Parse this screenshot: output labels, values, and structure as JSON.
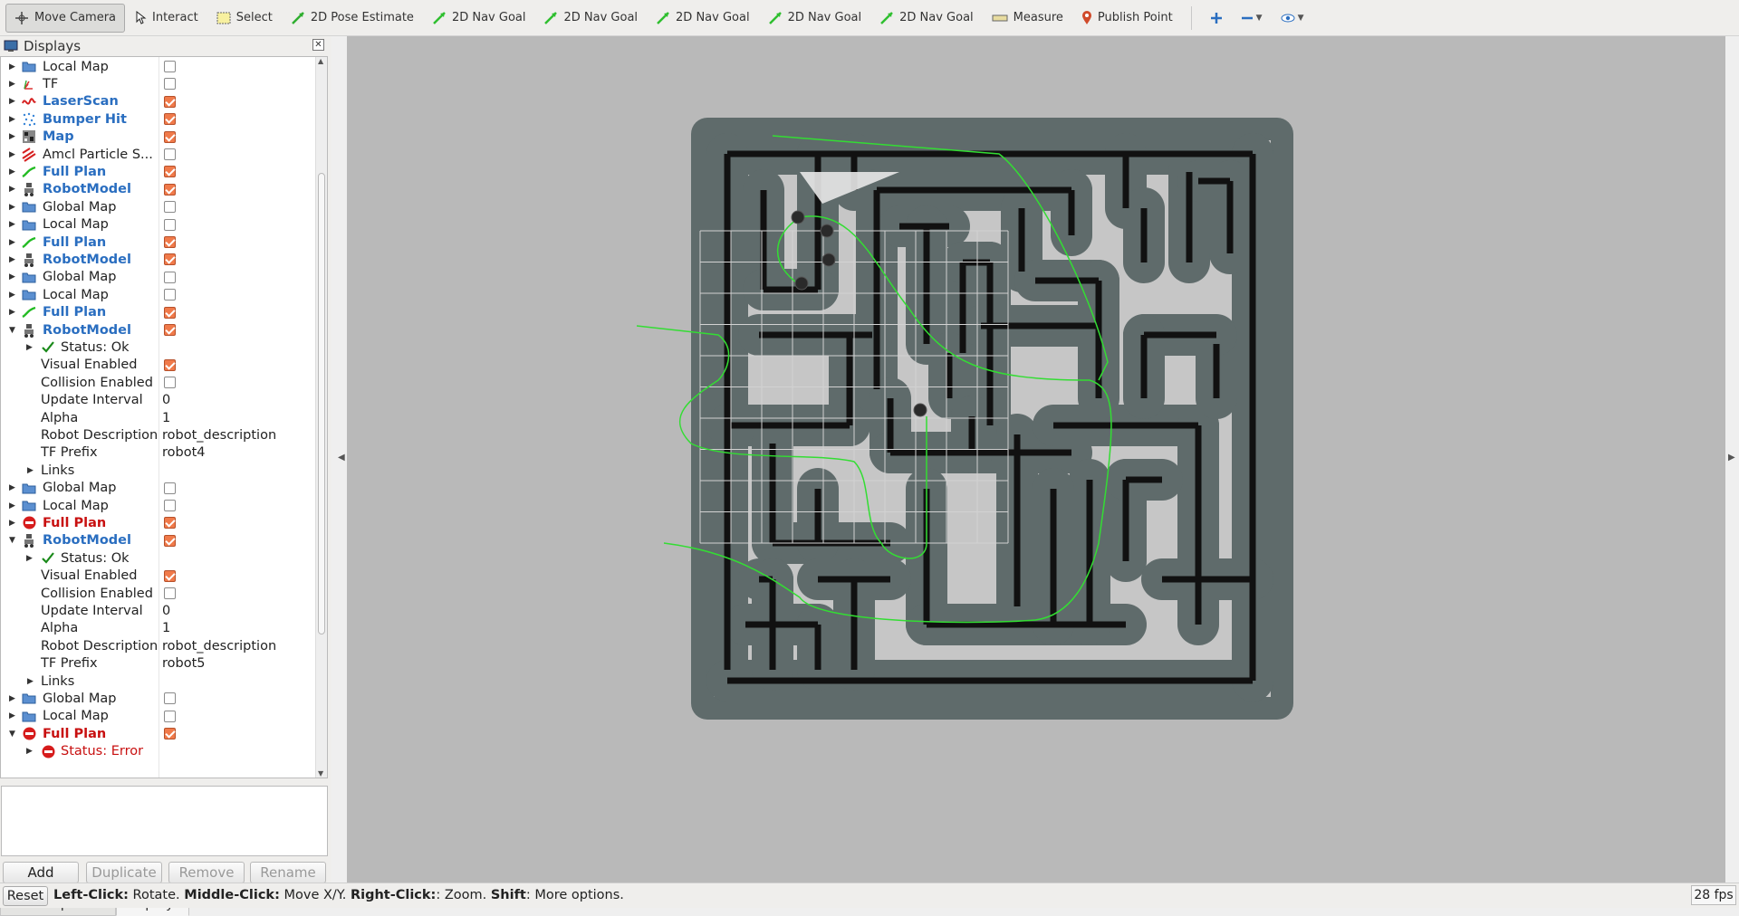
{
  "toolbar": {
    "tools": [
      {
        "label": "Move Camera",
        "icon": "move-camera-icon",
        "active": true
      },
      {
        "label": "Interact",
        "icon": "interact-icon"
      },
      {
        "label": "Select",
        "icon": "select-icon"
      },
      {
        "label": "2D Pose Estimate",
        "icon": "pose-estimate-icon"
      },
      {
        "label": "2D Nav Goal",
        "icon": "nav-goal-icon"
      },
      {
        "label": "2D Nav Goal",
        "icon": "nav-goal-icon"
      },
      {
        "label": "2D Nav Goal",
        "icon": "nav-goal-icon"
      },
      {
        "label": "2D Nav Goal",
        "icon": "nav-goal-icon"
      },
      {
        "label": "2D Nav Goal",
        "icon": "nav-goal-icon"
      },
      {
        "label": "Measure",
        "icon": "measure-icon"
      },
      {
        "label": "Publish Point",
        "icon": "publish-point-icon"
      }
    ]
  },
  "displays": {
    "title": "Displays",
    "rows": [
      {
        "label": "Local Map",
        "icon": "folder",
        "checked": false,
        "style": "",
        "arrow": "right",
        "indent": 0
      },
      {
        "label": "TF",
        "icon": "tf",
        "checked": false,
        "style": "",
        "arrow": "right",
        "indent": 0
      },
      {
        "label": "LaserScan",
        "icon": "laser",
        "checked": true,
        "style": "blue",
        "arrow": "right",
        "indent": 0
      },
      {
        "label": "Bumper Hit",
        "icon": "bumper",
        "checked": true,
        "style": "blue",
        "arrow": "right",
        "indent": 0
      },
      {
        "label": "Map",
        "icon": "map",
        "checked": true,
        "style": "blue",
        "arrow": "right",
        "indent": 0
      },
      {
        "label": "Amcl Particle S...",
        "icon": "particle",
        "checked": false,
        "style": "",
        "arrow": "right",
        "indent": 0
      },
      {
        "label": "Full Plan",
        "icon": "plan",
        "checked": true,
        "style": "blue",
        "arrow": "right",
        "indent": 0
      },
      {
        "label": "RobotModel",
        "icon": "robot",
        "checked": true,
        "style": "blue",
        "arrow": "right",
        "indent": 0
      },
      {
        "label": "Global Map",
        "icon": "folder",
        "checked": false,
        "style": "",
        "arrow": "right",
        "indent": 0
      },
      {
        "label": "Local Map",
        "icon": "folder",
        "checked": false,
        "style": "",
        "arrow": "right",
        "indent": 0
      },
      {
        "label": "Full Plan",
        "icon": "plan",
        "checked": true,
        "style": "blue",
        "arrow": "right",
        "indent": 0
      },
      {
        "label": "RobotModel",
        "icon": "robot",
        "checked": true,
        "style": "blue",
        "arrow": "right",
        "indent": 0
      },
      {
        "label": "Global Map",
        "icon": "folder",
        "checked": false,
        "style": "",
        "arrow": "right",
        "indent": 0
      },
      {
        "label": "Local Map",
        "icon": "folder",
        "checked": false,
        "style": "",
        "arrow": "right",
        "indent": 0
      },
      {
        "label": "Full Plan",
        "icon": "plan",
        "checked": true,
        "style": "blue",
        "arrow": "right",
        "indent": 0
      },
      {
        "label": "RobotModel",
        "icon": "robot",
        "checked": true,
        "style": "blue",
        "arrow": "down",
        "indent": 0
      },
      {
        "label": "Status: Ok",
        "icon": "ok",
        "style": "",
        "arrow": "right",
        "indent": 1
      },
      {
        "label": "Visual Enabled",
        "checked": true,
        "style": "",
        "indent": 2
      },
      {
        "label": "Collision Enabled",
        "checked": false,
        "style": "",
        "indent": 2
      },
      {
        "label": "Update Interval",
        "value": "0",
        "style": "",
        "indent": 2
      },
      {
        "label": "Alpha",
        "value": "1",
        "style": "",
        "indent": 2
      },
      {
        "label": "Robot Description",
        "value": "robot_description",
        "style": "",
        "indent": 2
      },
      {
        "label": "TF Prefix",
        "value": "robot4",
        "style": "",
        "indent": 2
      },
      {
        "label": "Links",
        "style": "",
        "arrow": "right",
        "indent": 3
      },
      {
        "label": "Global Map",
        "icon": "folder",
        "checked": false,
        "style": "",
        "arrow": "right",
        "indent": 0
      },
      {
        "label": "Local Map",
        "icon": "folder",
        "checked": false,
        "style": "",
        "arrow": "right",
        "indent": 0
      },
      {
        "label": "Full Plan",
        "icon": "error",
        "checked": true,
        "style": "red",
        "arrow": "right",
        "indent": 0
      },
      {
        "label": "RobotModel",
        "icon": "robot",
        "checked": true,
        "style": "blue",
        "arrow": "down",
        "indent": 0
      },
      {
        "label": "Status: Ok",
        "icon": "ok",
        "style": "",
        "arrow": "right",
        "indent": 1
      },
      {
        "label": "Visual Enabled",
        "checked": true,
        "style": "",
        "indent": 2
      },
      {
        "label": "Collision Enabled",
        "checked": false,
        "style": "",
        "indent": 2
      },
      {
        "label": "Update Interval",
        "value": "0",
        "style": "",
        "indent": 2
      },
      {
        "label": "Alpha",
        "value": "1",
        "style": "",
        "indent": 2
      },
      {
        "label": "Robot Description",
        "value": "robot_description",
        "style": "",
        "indent": 2
      },
      {
        "label": "TF Prefix",
        "value": "robot5",
        "style": "",
        "indent": 2
      },
      {
        "label": "Links",
        "style": "",
        "arrow": "right",
        "indent": 3
      },
      {
        "label": "Global Map",
        "icon": "folder",
        "checked": false,
        "style": "",
        "arrow": "right",
        "indent": 0
      },
      {
        "label": "Local Map",
        "icon": "folder",
        "checked": false,
        "style": "",
        "arrow": "right",
        "indent": 0
      },
      {
        "label": "Full Plan",
        "icon": "error",
        "checked": true,
        "style": "red",
        "arrow": "down",
        "indent": 0
      },
      {
        "label": "Status: Error",
        "icon": "error",
        "style": "redn",
        "arrow": "right",
        "indent": 1
      }
    ],
    "buttons": {
      "add": "Add",
      "duplicate": "Duplicate",
      "remove": "Remove",
      "rename": "Rename"
    },
    "tabs": {
      "tool_properties": "Tool Properties",
      "displays": "Displays"
    }
  },
  "statusbar": {
    "reset": "Reset",
    "hint_parts": [
      {
        "bold": "Left-Click:",
        "text": " Rotate. "
      },
      {
        "bold": "Middle-Click:",
        "text": " Move X/Y. "
      },
      {
        "bold": "Right-Click:",
        "text": ": Zoom. "
      },
      {
        "bold": "Shift",
        "text": ": More options."
      }
    ],
    "fps": "28 fps"
  },
  "colors": {
    "viewport_bg": "#b9b9b9",
    "free_space": "#c6c6c6",
    "inflation": "#5f6b6b",
    "wall": "#111111",
    "path": "#33dd33",
    "checkbox_on": "#f07a4a",
    "blue_label": "#2a6ec0",
    "red_label": "#c81010"
  }
}
